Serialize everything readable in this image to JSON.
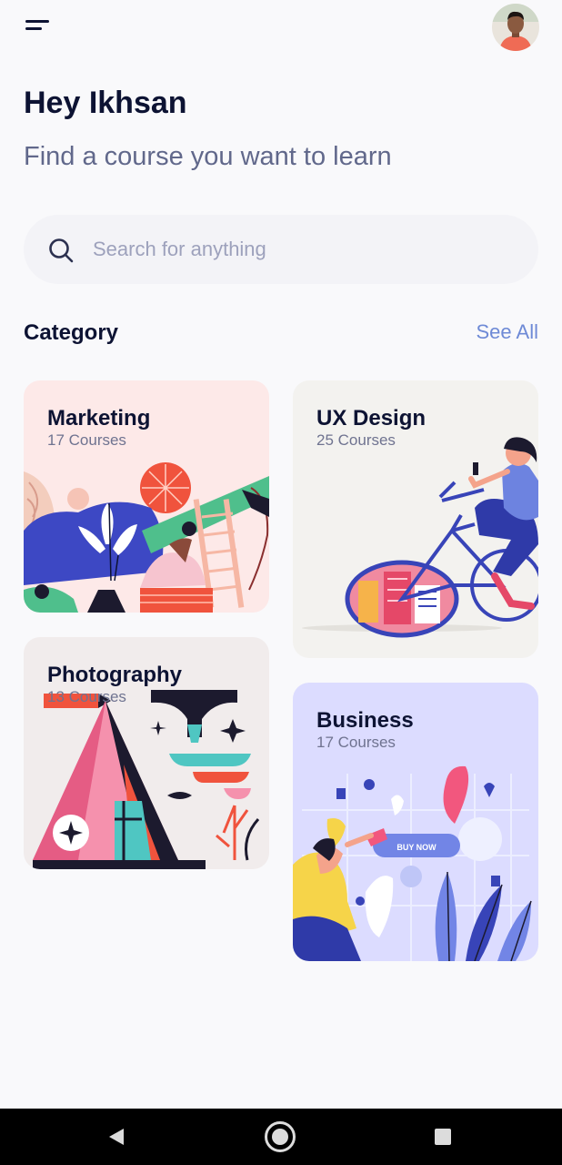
{
  "header": {
    "menu_icon": "menu-icon",
    "avatar_icon": "user-avatar"
  },
  "greeting": "Hey Ikhsan",
  "subtitle": "Find a course you want to learn",
  "search": {
    "placeholder": "Search for anything",
    "icon": "search-icon"
  },
  "category": {
    "title": "Category",
    "see_all": "See All",
    "cards": [
      {
        "name": "Marketing",
        "count": "17 Courses"
      },
      {
        "name": "UX Design",
        "count": "25 Courses"
      },
      {
        "name": "Photography",
        "count": "13 Courses"
      },
      {
        "name": "Business",
        "count": "17 Courses"
      }
    ]
  },
  "business_art_label": "BUY NOW",
  "nav": {
    "back_icon": "back-icon",
    "home_icon": "home-icon",
    "recents_icon": "recents-icon"
  },
  "colors": {
    "primary_text": "#0d1333",
    "secondary_text": "#61688b",
    "link": "#6e8ad6",
    "marketing_bg": "#fde9e8",
    "ux_bg": "#f3f2ef",
    "photo_bg": "#f1ecec",
    "business_bg": "#dcdcff"
  }
}
